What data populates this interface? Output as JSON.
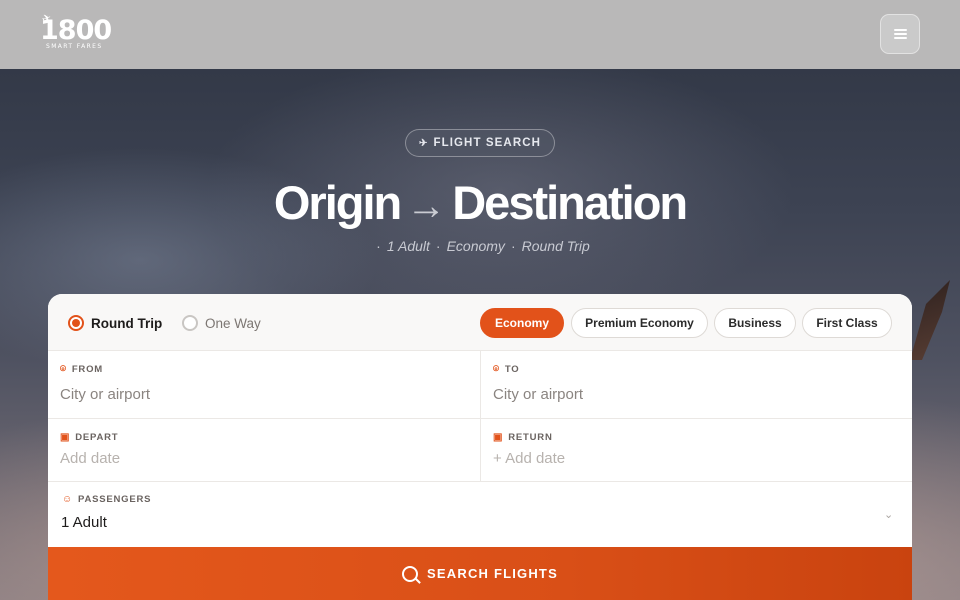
{
  "header": {
    "logo_number": "1800",
    "logo_tagline": "SMART FARES",
    "menu_icon": "hamburger-icon"
  },
  "hero": {
    "pill_icon": "plane-icon",
    "pill_label": "FLIGHT SEARCH",
    "title_origin": "Origin",
    "title_arrow": "→",
    "title_destination": "Destination",
    "sub_separator": "·",
    "sub_passengers": "1 Adult",
    "sub_cabin": "Economy",
    "sub_trip": "Round Trip"
  },
  "trip_types": [
    {
      "label": "Round Trip",
      "selected": true
    },
    {
      "label": "One Way",
      "selected": false
    }
  ],
  "cabin_classes": [
    {
      "label": "Economy",
      "selected": true
    },
    {
      "label": "Premium Economy",
      "selected": false
    },
    {
      "label": "Business",
      "selected": false
    },
    {
      "label": "First Class",
      "selected": false
    }
  ],
  "fields": {
    "from": {
      "label": "FROM",
      "icon": "location-pin-icon",
      "placeholder": "City or airport"
    },
    "to": {
      "label": "TO",
      "icon": "location-pin-icon",
      "placeholder": "City or airport"
    },
    "depart": {
      "label": "DEPART",
      "icon": "calendar-icon",
      "placeholder": "Add date"
    },
    "return": {
      "label": "RETURN",
      "icon": "calendar-icon",
      "placeholder": "+ Add date"
    },
    "passengers": {
      "label": "PASSENGERS",
      "icon": "users-icon",
      "value": "1 Adult",
      "chevron": "⌄"
    }
  },
  "search_button": {
    "label": "SEARCH FLIGHTS",
    "icon": "search-icon"
  },
  "colors": {
    "accent": "#e2521a",
    "header_bg": "#b9b8b8"
  }
}
